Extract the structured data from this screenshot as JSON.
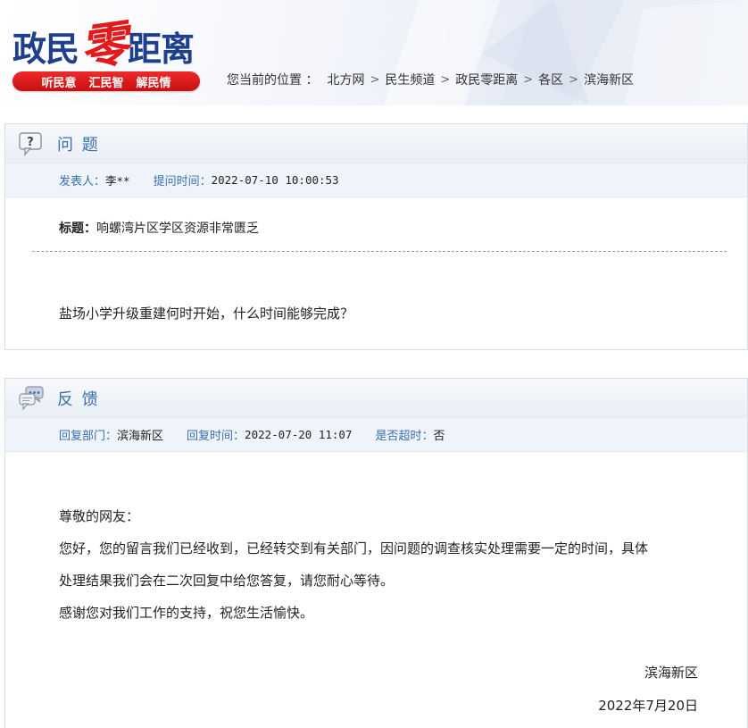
{
  "header": {
    "logo": {
      "part1": "政民",
      "part2": "零",
      "part3": "距离"
    },
    "slogan": [
      "听民意",
      "汇民智",
      "解民情"
    ],
    "breadcrumb": {
      "lead": "您当前的位置 ：",
      "items": [
        "北方网",
        "民生频道",
        "政民零距离",
        "各区",
        "滨海新区"
      ]
    }
  },
  "question": {
    "section_title": "问 题",
    "icon": "question-bubble-icon",
    "poster_label": "发表人：",
    "poster": "李**",
    "time_label": "提问时间：",
    "time": "2022-07-10 10:00:53",
    "title_label": "标题：",
    "title": "响螺湾片区学区资源非常匮乏",
    "body": "盐场小学升级重建何时开始，什么时间能够完成？"
  },
  "reply": {
    "section_title": "反 馈",
    "icon": "chat-bubbles-icon",
    "dept_label": "回复部门：",
    "dept": "滨海新区",
    "time_label": "回复时间：",
    "time": "2022-07-20 11:07",
    "overdue_label": "是否超时：",
    "overdue": "否",
    "greeting": "尊敬的网友：",
    "line1": "您好，您的留言我们已经收到，已经转交到有关部门，因问题的调查核实处理需要一定的时间，具体",
    "line2": "处理结果我们会在二次回复中给您答复，请您耐心等待。",
    "line3": "感谢您对我们工作的支持，祝您生活愉快。",
    "sign_org": "滨海新区",
    "sign_date": "2022年7月20日"
  },
  "colors": {
    "brand_blue": "#1d3f8e",
    "accent_red": "#e31a1c",
    "label_blue": "#3a6fb0"
  }
}
